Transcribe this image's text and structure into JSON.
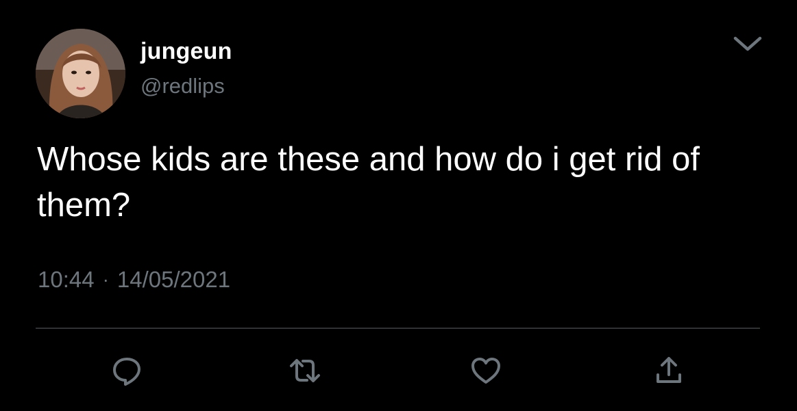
{
  "tweet": {
    "author": {
      "display_name": "jungeun",
      "handle": "@redlips",
      "avatar_icon": "profile-photo"
    },
    "text": "Whose kids are these and how do i get rid of them?",
    "time": "10:44",
    "separator": "·",
    "date": "14/05/2021",
    "actions": [
      {
        "name": "reply",
        "icon": "reply-icon"
      },
      {
        "name": "retweet",
        "icon": "retweet-icon"
      },
      {
        "name": "like",
        "icon": "heart-icon"
      },
      {
        "name": "share",
        "icon": "share-icon"
      }
    ]
  },
  "colors": {
    "background": "#000000",
    "primary_text": "#ffffff",
    "secondary_text": "#6e767d",
    "divider": "#2f3336"
  }
}
